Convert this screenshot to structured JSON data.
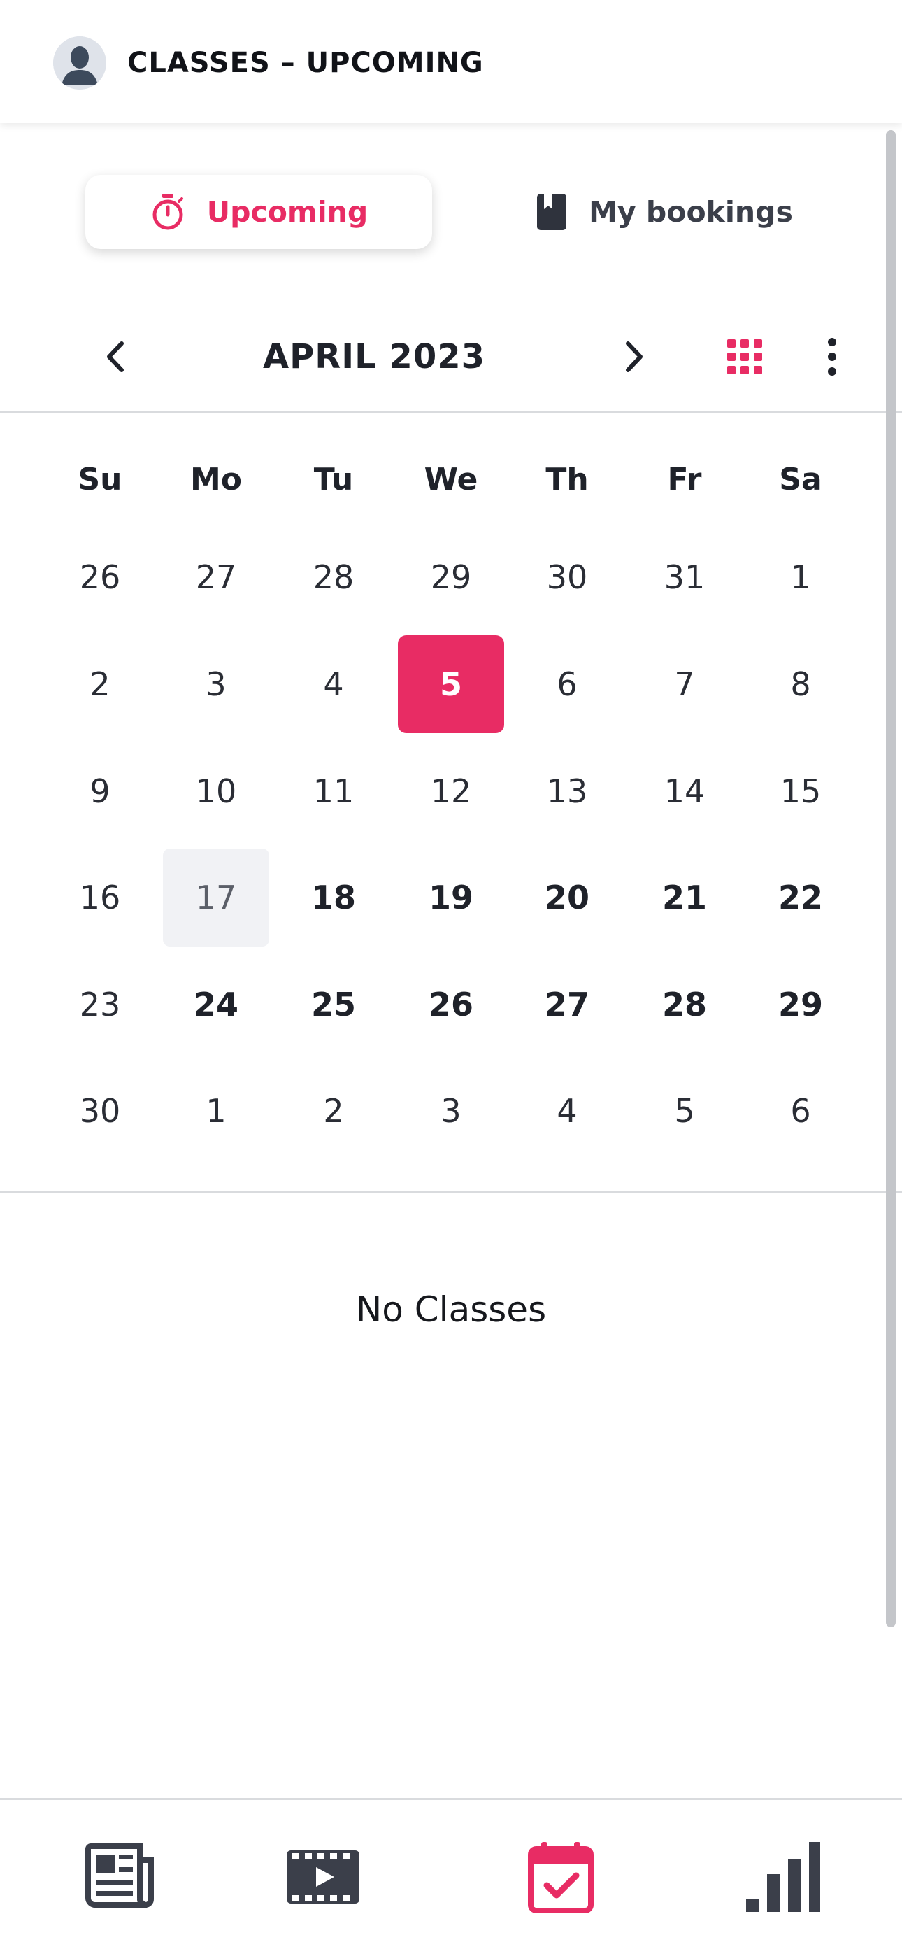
{
  "header": {
    "title": "CLASSES – UPCOMING",
    "avatar_icon": "user-silhouette-icon"
  },
  "tabs": [
    {
      "label": "Upcoming",
      "icon": "stopwatch-icon",
      "active": true,
      "color": "#e82c64"
    },
    {
      "label": "My bookings",
      "icon": "bookmark-book-icon",
      "active": false
    }
  ],
  "calendar": {
    "month_label": "APRIL 2023",
    "weekdays": [
      "Su",
      "Mo",
      "Tu",
      "We",
      "Th",
      "Fr",
      "Sa"
    ],
    "weeks": [
      [
        "26",
        "27",
        "28",
        "29",
        "30",
        "31",
        "1"
      ],
      [
        "2",
        "3",
        "4",
        "5",
        "6",
        "7",
        "8"
      ],
      [
        "9",
        "10",
        "11",
        "12",
        "13",
        "14",
        "15"
      ],
      [
        "16",
        "17",
        "18",
        "19",
        "20",
        "21",
        "22"
      ],
      [
        "23",
        "24",
        "25",
        "26",
        "27",
        "28",
        "29"
      ],
      [
        "30",
        "1",
        "2",
        "3",
        "4",
        "5",
        "6"
      ]
    ],
    "selected_date": "5",
    "accent_color": "#e82c64"
  },
  "empty_state": "No Classes",
  "bottom_nav": [
    {
      "icon": "newspaper-icon",
      "active": false
    },
    {
      "icon": "video-film-icon",
      "active": false
    },
    {
      "icon": "calendar-check-icon",
      "active": true
    },
    {
      "icon": "bar-chart-icon",
      "active": false
    }
  ]
}
